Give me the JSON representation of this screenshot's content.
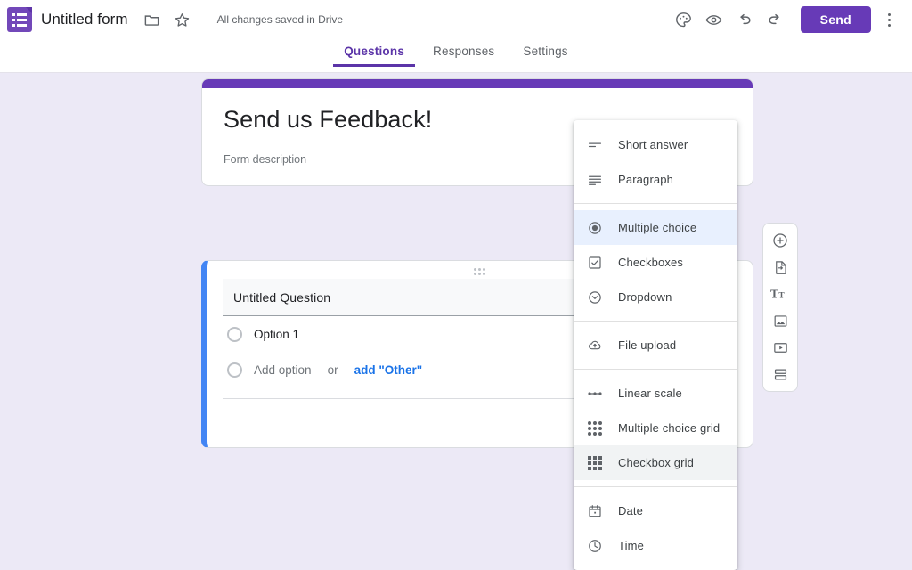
{
  "app": {
    "logo_icon": "google-forms-logo",
    "form_title": "Untitled form",
    "folder_icon": "folder-icon",
    "star_icon": "star-icon",
    "save_status": "All changes saved in Drive",
    "theme_icon": "palette-icon",
    "preview_icon": "eye-preview-icon",
    "undo_icon": "undo-icon",
    "redo_icon": "redo-icon",
    "send_label": "Send",
    "more_icon": "kebab-more-icon"
  },
  "tabs": [
    {
      "label": "Questions",
      "active": true
    },
    {
      "label": "Responses",
      "active": false
    },
    {
      "label": "Settings",
      "active": false
    }
  ],
  "form_header": {
    "title": "Send us Feedback!",
    "description": "Form description",
    "accent_color": "#673ab7"
  },
  "question_card": {
    "selected_accent": "#4285f4",
    "drag_handle_icon": "drag-handle-dots-icon",
    "question_title": "Untitled Question",
    "add_image_icon": "image-icon",
    "options": [
      {
        "label": "Option 1",
        "icon": "radio-unchecked-icon"
      }
    ],
    "add_option_label": "Add option",
    "or_label": "or",
    "add_other_label": "add \"Other\"",
    "duplicate_icon": "duplicate-icon"
  },
  "side_toolbar": [
    {
      "name": "add-question",
      "icon": "plus-circle-icon"
    },
    {
      "name": "import-questions",
      "icon": "import-questions-icon"
    },
    {
      "name": "add-title-and-description",
      "icon": "title-text-icon",
      "glyph": "Tт"
    },
    {
      "name": "add-image",
      "icon": "image-icon"
    },
    {
      "name": "add-video",
      "icon": "video-icon"
    },
    {
      "name": "add-section",
      "icon": "add-section-icon"
    }
  ],
  "type_menu": {
    "groups": [
      {
        "items": [
          {
            "label": "Short answer",
            "icon": "short-answer-icon",
            "state": "normal"
          },
          {
            "label": "Paragraph",
            "icon": "paragraph-icon",
            "state": "normal"
          }
        ]
      },
      {
        "items": [
          {
            "label": "Multiple choice",
            "icon": "radio-filled-icon",
            "state": "selected"
          },
          {
            "label": "Checkboxes",
            "icon": "checkbox-checked-icon",
            "state": "normal"
          },
          {
            "label": "Dropdown",
            "icon": "chevron-down-circle-icon",
            "state": "normal"
          }
        ]
      },
      {
        "items": [
          {
            "label": "File upload",
            "icon": "cloud-upload-icon",
            "state": "normal"
          }
        ]
      },
      {
        "items": [
          {
            "label": "Linear scale",
            "icon": "linear-scale-icon",
            "state": "normal"
          },
          {
            "label": "Multiple choice grid",
            "icon": "radio-grid-icon",
            "state": "normal"
          },
          {
            "label": "Checkbox grid",
            "icon": "checkbox-grid-icon",
            "state": "hovered"
          }
        ]
      },
      {
        "items": [
          {
            "label": "Date",
            "icon": "calendar-icon",
            "state": "normal"
          },
          {
            "label": "Time",
            "icon": "clock-icon",
            "state": "normal"
          }
        ]
      }
    ]
  }
}
